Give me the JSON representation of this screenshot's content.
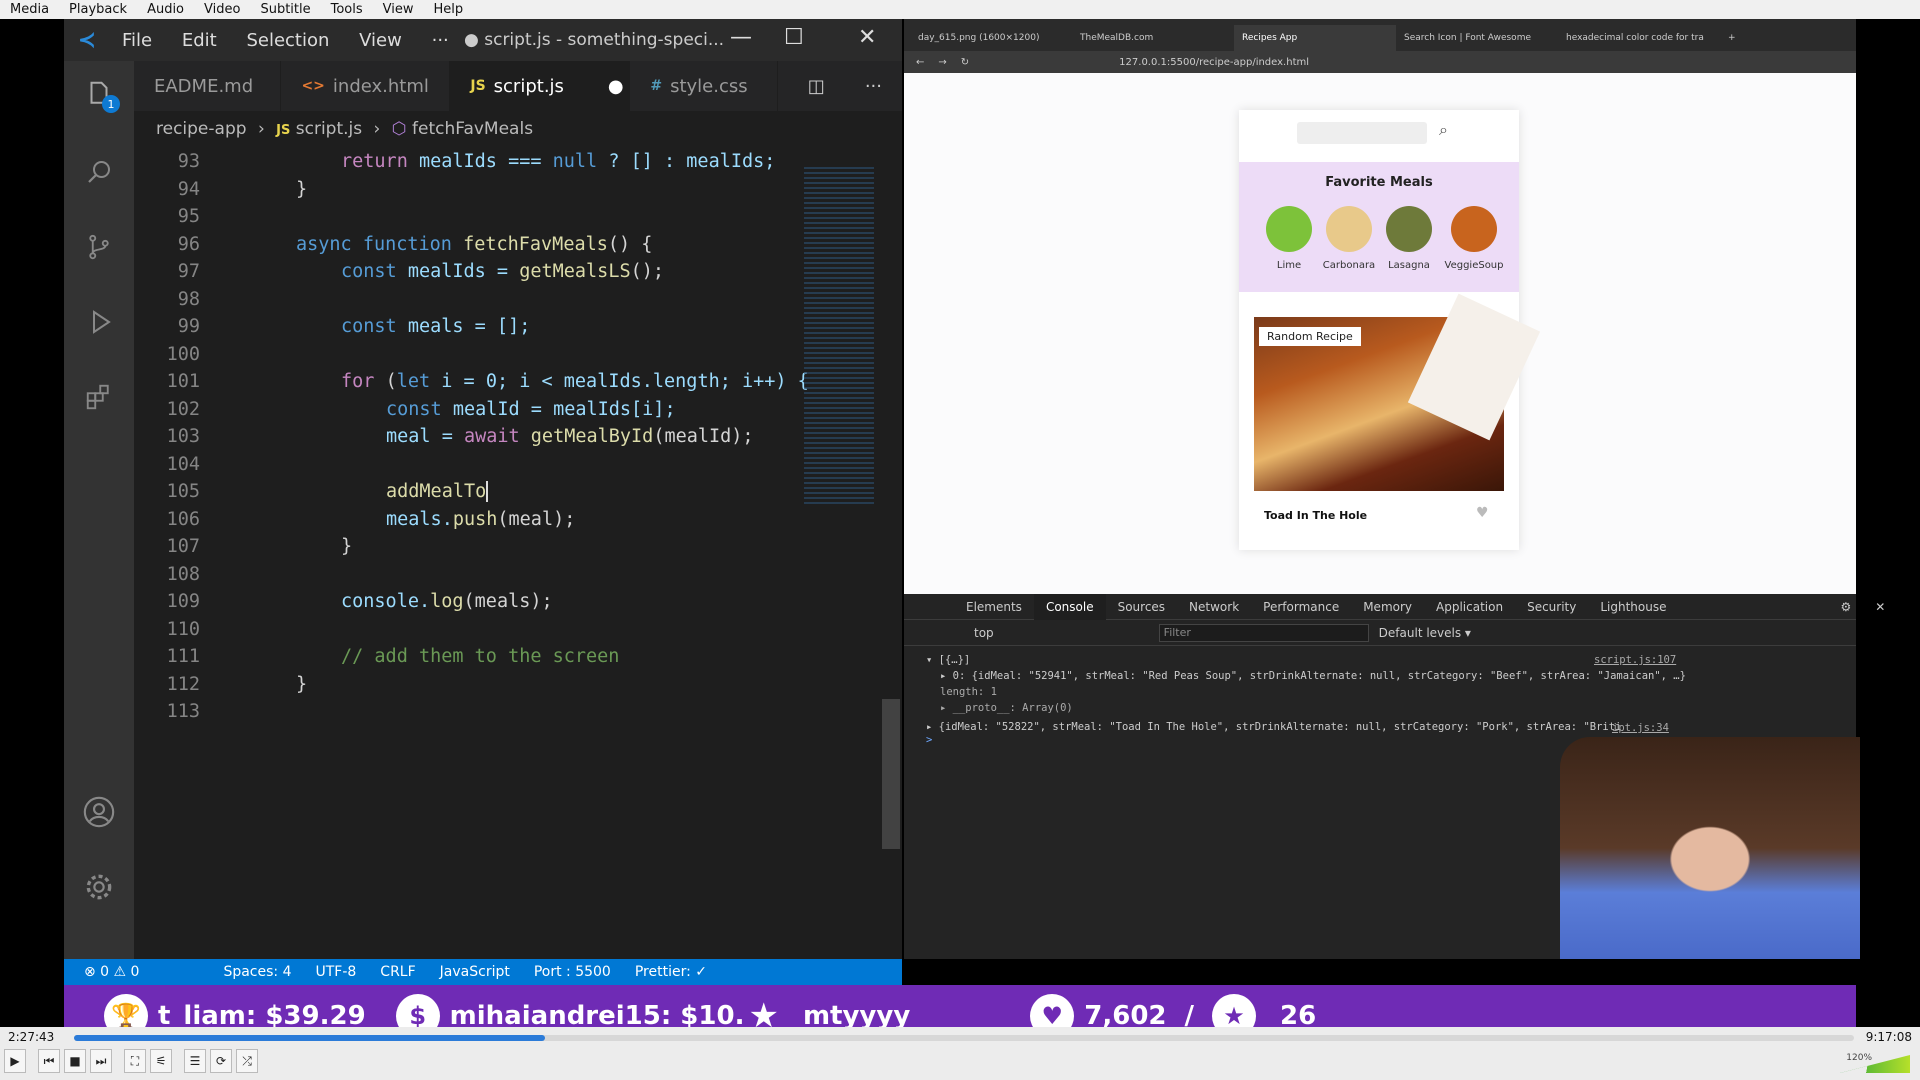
{
  "menubar": [
    "Media",
    "Playback",
    "Audio",
    "Video",
    "Subtitle",
    "Tools",
    "View",
    "Help"
  ],
  "vscode": {
    "menus": [
      "File",
      "Edit",
      "Selection",
      "View",
      "···"
    ],
    "window_title": "● script.js - something-speci...",
    "explorer_badge": "1",
    "tabs": [
      {
        "icon": "",
        "label": "EADME.md"
      },
      {
        "icon": "<>",
        "label": "index.html"
      },
      {
        "icon": "JS",
        "label": "script.js",
        "dirty": "●"
      },
      {
        "icon": "#",
        "label": "style.css"
      }
    ],
    "breadcrumb": {
      "folder": "recipe-app",
      "file": "script.js",
      "symbol": "fetchFavMeals"
    },
    "lines": [
      {
        "n": "93"
      },
      {
        "n": "94"
      },
      {
        "n": "95"
      },
      {
        "n": "96"
      },
      {
        "n": "97"
      },
      {
        "n": "98"
      },
      {
        "n": "99"
      },
      {
        "n": "100"
      },
      {
        "n": "101"
      },
      {
        "n": "102"
      },
      {
        "n": "103"
      },
      {
        "n": "104"
      },
      {
        "n": "105"
      },
      {
        "n": "106"
      },
      {
        "n": "107"
      },
      {
        "n": "108"
      },
      {
        "n": "109"
      },
      {
        "n": "110"
      },
      {
        "n": "111"
      },
      {
        "n": "112"
      },
      {
        "n": "113"
      }
    ],
    "code": {
      "l93a": "return",
      "l93b": " mealIds === ",
      "l93c": "null",
      "l93d": " ? [] : mealIds;",
      "l94": "}",
      "l96a": "async function ",
      "l96b": "fetchFavMeals",
      "l96c": "() {",
      "l97a": "const ",
      "l97b": "mealIds = ",
      "l97c": "getMealsLS",
      "l97d": "();",
      "l99a": "const ",
      "l99b": "meals = [];",
      "l101a": "for ",
      "l101b": "(",
      "l101c": "let ",
      "l101d": "i = 0; i < mealIds.length; i++) {",
      "l102a": "const ",
      "l102b": "mealId = mealIds[i];",
      "l103a": "meal = ",
      "l103b": "await ",
      "l103c": "getMealById",
      "l103d": "(mealId);",
      "l105": "addMealTo",
      "l106a": "meals.",
      "l106b": "push",
      "l106c": "(meal);",
      "l107": "}",
      "l109a": "console.",
      "l109b": "log",
      "l109c": "(meals);",
      "l111": "// add them to the screen",
      "l112": "}"
    },
    "status": [
      "⊗ 0 ⚠ 0",
      "Spaces: 4",
      "UTF-8",
      "CRLF",
      "JavaScript",
      "Port : 5500",
      "Prettier: ✓"
    ]
  },
  "browser": {
    "tabs": [
      "day_615.png (1600×1200)",
      "TheMealDB.com",
      "Recipes App",
      "Search Icon | Font Awesome",
      "hexadecimal color code for tra"
    ],
    "url": "127.0.0.1:5500/recipe-app/index.html",
    "app": {
      "fav_title": "Favorite Meals",
      "meals": [
        {
          "name": "Lime",
          "color": "#7dc23a"
        },
        {
          "name": "Carbonara",
          "color": "#e8c98a"
        },
        {
          "name": "Lasagna",
          "color": "#6e7a3a"
        },
        {
          "name": "VeggieSoup",
          "color": "#c8641e"
        }
      ],
      "random_label": "Random Recipe",
      "recipe_name": "Toad In The Hole"
    }
  },
  "devtools": {
    "tabs": [
      "Elements",
      "Console",
      "Sources",
      "Network",
      "Performance",
      "Memory",
      "Application",
      "Security",
      "Lighthouse"
    ],
    "context": "top",
    "filter_placeholder": "Filter",
    "levels": "Default levels ▾",
    "log1_head": "▾ [{…}]",
    "log1_item": "▸ 0: {idMeal: \"52941\", strMeal: \"Red Peas Soup\", strDrinkAlternate: null, strCategory: \"Beef\", strArea: \"Jamaican\", …}",
    "log1_len": "length: 1",
    "log1_proto": "▸ __proto__: Array(0)",
    "log1_src": "script.js:107",
    "log2": "▸ {idMeal: \"52822\", strMeal: \"Toad In The Hole\", strDrinkAlternate: null, strCategory: \"Pork\", strArea: \"Briti",
    "log2_src": "ipt.js:34",
    "prompt": ">"
  },
  "stream_bar": {
    "donor1": "t_liam: $39.29",
    "donor2": "mihaiandrei15: $10.",
    "follower": "mtyyyy",
    "likes": "7,602",
    "sep": "/",
    "stars": "26"
  },
  "player": {
    "elapsed": "2:27:43",
    "total": "9:17:08",
    "progress": 0.2646,
    "volume": "120%"
  }
}
